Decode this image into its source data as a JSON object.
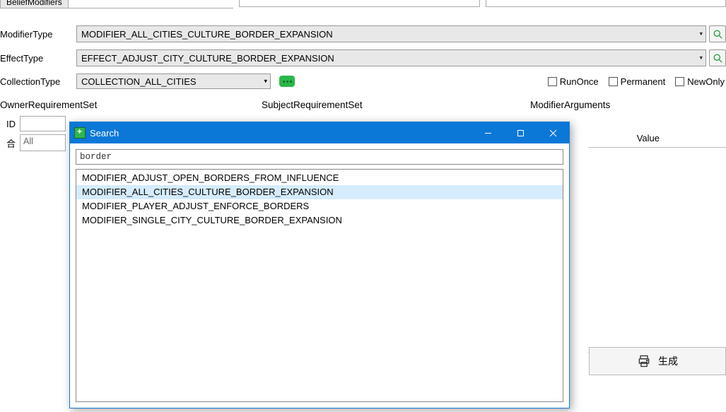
{
  "tabs": {
    "beliefModifiers": "BeliefModifiers"
  },
  "fields": {
    "modifierType": {
      "label": "ModifierType",
      "value": "MODIFIER_ALL_CITIES_CULTURE_BORDER_EXPANSION"
    },
    "effectType": {
      "label": "EffectType",
      "value": "EFFECT_ADJUST_CITY_CULTURE_BORDER_EXPANSION"
    },
    "collectionType": {
      "label": "CollectionType",
      "value": "COLLECTION_ALL_CITIES"
    }
  },
  "checkboxes": {
    "runOnce": "RunOnce",
    "permanent": "Permanent",
    "newOnly": "NewOnly"
  },
  "sections": {
    "ownerReq": "OwnerRequirementSet",
    "subjectReq": "SubjectRequirementSet",
    "modArgs": "ModifierArguments"
  },
  "idRow": {
    "label": "ID"
  },
  "filterRow": {
    "label": "合",
    "filter_text": "All"
  },
  "valueHeader": "Value",
  "generate": "生成",
  "searchDialog": {
    "title": "Search",
    "query": "border",
    "results": [
      "MODIFIER_ADJUST_OPEN_BORDERS_FROM_INFLUENCE",
      "MODIFIER_ALL_CITIES_CULTURE_BORDER_EXPANSION",
      "MODIFIER_PLAYER_ADJUST_ENFORCE_BORDERS",
      "MODIFIER_SINGLE_CITY_CULTURE_BORDER_EXPANSION"
    ],
    "selectedIndex": 1
  }
}
